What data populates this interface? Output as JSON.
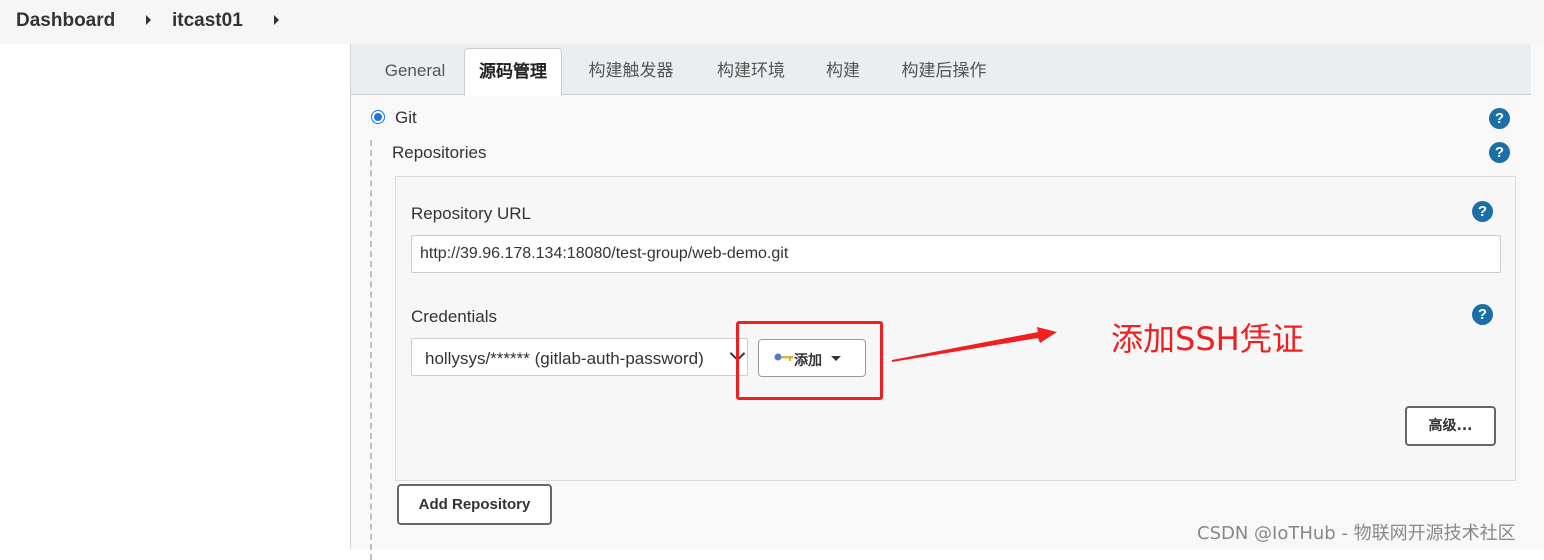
{
  "breadcrumb": {
    "items": [
      "Dashboard",
      "itcast01"
    ]
  },
  "tabs": [
    {
      "label": "General"
    },
    {
      "label": "源码管理"
    },
    {
      "label": "构建触发器"
    },
    {
      "label": "构建环境"
    },
    {
      "label": "构建"
    },
    {
      "label": "构建后操作"
    }
  ],
  "active_tab": "源码管理",
  "scm": {
    "git_label": "Git",
    "git_selected": true,
    "repositories_label": "Repositories",
    "repository_url_label": "Repository URL",
    "repository_url_value": "http://39.96.178.134:18080/test-group/web-demo.git",
    "credentials_label": "Credentials",
    "credentials_value": "hollysys/****** (gitlab-auth-password)",
    "add_button_label": "添加",
    "advanced_button_label": "高级...",
    "add_repository_label": "Add Repository"
  },
  "help_icon_glyph": "?",
  "annotation": {
    "text": "添加SSH凭证",
    "color": "#f02020"
  },
  "watermark": "CSDN @IoTHub - 物联网开源技术社区"
}
